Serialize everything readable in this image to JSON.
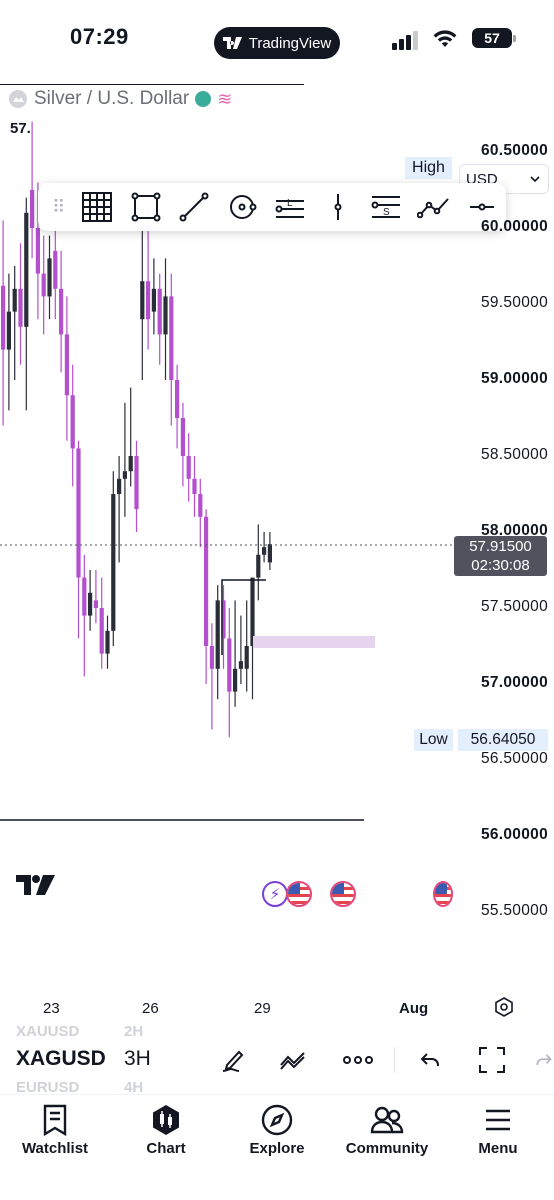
{
  "status_bar": {
    "time": "07:29",
    "app_pill": "TradingView",
    "battery": "57"
  },
  "chart": {
    "symbol_title": "Silver / U.S. Dollar",
    "open_value": "57.",
    "high_label": "High",
    "low_label": "Low",
    "low_value": "56.64050",
    "currency": "USD",
    "last_price": "57.91500",
    "countdown": "02:30:08",
    "price_ticks": [
      {
        "label": "60.50000",
        "bold": true
      },
      {
        "label": "60.00000",
        "bold": true
      },
      {
        "label": "59.50000",
        "bold": false
      },
      {
        "label": "59.00000",
        "bold": true
      },
      {
        "label": "58.50000",
        "bold": false
      },
      {
        "label": "58.00000",
        "bold": true
      },
      {
        "label": "57.50000",
        "bold": false
      },
      {
        "label": "57.00000",
        "bold": true
      },
      {
        "label": "56.50000",
        "bold": false
      },
      {
        "label": "56.00000",
        "bold": true
      },
      {
        "label": "55.50000",
        "bold": false
      }
    ],
    "time_labels": [
      "23",
      "26",
      "29",
      "Aug"
    ],
    "colors": {
      "down": "#b44fce",
      "up": "#2a2e39",
      "zone": "#e6d4ef",
      "accent_badge": "#e3effd"
    }
  },
  "drawing_tools": [
    {
      "name": "grid-icon"
    },
    {
      "name": "rectangle-icon"
    },
    {
      "name": "trend-line-icon"
    },
    {
      "name": "circle-icon"
    },
    {
      "name": "long-position-icon"
    },
    {
      "name": "vertical-line-icon"
    },
    {
      "name": "short-position-icon"
    },
    {
      "name": "path-icon"
    },
    {
      "name": "horizontal-ray-icon"
    }
  ],
  "symbol_bar": {
    "prev_symbol": "XAUUSD",
    "prev_interval": "2H",
    "symbol": "XAGUSD",
    "interval": "3H",
    "next_symbol": "EURUSD",
    "next_interval": "4H"
  },
  "tabs": [
    {
      "label": "Watchlist",
      "icon": "watchlist-icon"
    },
    {
      "label": "Chart",
      "icon": "chart-icon"
    },
    {
      "label": "Explore",
      "icon": "compass-icon"
    },
    {
      "label": "Community",
      "icon": "community-icon"
    },
    {
      "label": "Menu",
      "icon": "menu-icon"
    }
  ],
  "candles": [
    {
      "t": 0,
      "o": 59.62,
      "h": 60.05,
      "l": 58.7,
      "c": 59.2
    },
    {
      "t": 1,
      "o": 59.2,
      "h": 59.7,
      "l": 58.8,
      "c": 59.45
    },
    {
      "t": 2,
      "o": 59.45,
      "h": 59.75,
      "l": 59.0,
      "c": 59.6
    },
    {
      "t": 3,
      "o": 59.6,
      "h": 59.9,
      "l": 59.1,
      "c": 59.35
    },
    {
      "t": 4,
      "o": 59.35,
      "h": 60.2,
      "l": 58.8,
      "c": 60.1
    },
    {
      "t": 5,
      "o": 60.25,
      "h": 60.7,
      "l": 59.8,
      "c": 60.0
    },
    {
      "t": 6,
      "o": 60.0,
      "h": 60.3,
      "l": 59.4,
      "c": 59.7
    },
    {
      "t": 7,
      "o": 59.7,
      "h": 59.95,
      "l": 59.3,
      "c": 59.55
    },
    {
      "t": 8,
      "o": 59.55,
      "h": 59.95,
      "l": 59.4,
      "c": 59.8
    },
    {
      "t": 9,
      "o": 59.85,
      "h": 60.0,
      "l": 59.4,
      "c": 59.6
    },
    {
      "t": 10,
      "o": 59.6,
      "h": 59.85,
      "l": 59.05,
      "c": 59.3
    },
    {
      "t": 11,
      "o": 59.3,
      "h": 59.55,
      "l": 58.6,
      "c": 58.9
    },
    {
      "t": 12,
      "o": 58.9,
      "h": 59.1,
      "l": 58.3,
      "c": 58.55
    },
    {
      "t": 13,
      "o": 58.55,
      "h": 58.6,
      "l": 57.3,
      "c": 57.7
    },
    {
      "t": 14,
      "o": 57.7,
      "h": 57.85,
      "l": 57.05,
      "c": 57.45
    },
    {
      "t": 15,
      "o": 57.45,
      "h": 57.75,
      "l": 57.35,
      "c": 57.6
    },
    {
      "t": 16,
      "o": 57.55,
      "h": 57.75,
      "l": 57.4,
      "c": 57.5
    },
    {
      "t": 17,
      "o": 57.5,
      "h": 57.7,
      "l": 57.1,
      "c": 57.2
    },
    {
      "t": 18,
      "o": 57.2,
      "h": 57.45,
      "l": 57.1,
      "c": 57.35
    },
    {
      "t": 19,
      "o": 57.35,
      "h": 58.4,
      "l": 57.25,
      "c": 58.25
    },
    {
      "t": 20,
      "o": 58.25,
      "h": 58.5,
      "l": 57.8,
      "c": 58.35
    },
    {
      "t": 21,
      "o": 58.35,
      "h": 58.85,
      "l": 58.1,
      "c": 58.4
    },
    {
      "t": 22,
      "o": 58.4,
      "h": 58.95,
      "l": 58.3,
      "c": 58.5
    },
    {
      "t": 23,
      "o": 58.5,
      "h": 58.6,
      "l": 58.0,
      "c": 58.15
    },
    {
      "t": 24,
      "o": 59.4,
      "h": 60.0,
      "l": 59.0,
      "c": 59.65
    },
    {
      "t": 25,
      "o": 59.65,
      "h": 60.1,
      "l": 59.2,
      "c": 59.4
    },
    {
      "t": 26,
      "o": 59.45,
      "h": 59.8,
      "l": 59.3,
      "c": 59.6
    },
    {
      "t": 27,
      "o": 59.6,
      "h": 59.7,
      "l": 59.1,
      "c": 59.3
    },
    {
      "t": 28,
      "o": 59.3,
      "h": 59.8,
      "l": 59.0,
      "c": 59.55
    },
    {
      "t": 29,
      "o": 59.55,
      "h": 59.7,
      "l": 58.7,
      "c": 59.0
    },
    {
      "t": 30,
      "o": 59.0,
      "h": 59.1,
      "l": 58.55,
      "c": 58.75
    },
    {
      "t": 31,
      "o": 58.75,
      "h": 58.85,
      "l": 58.3,
      "c": 58.5
    },
    {
      "t": 32,
      "o": 58.5,
      "h": 58.65,
      "l": 58.2,
      "c": 58.35
    },
    {
      "t": 33,
      "o": 58.35,
      "h": 58.5,
      "l": 58.1,
      "c": 58.25
    },
    {
      "t": 34,
      "o": 58.25,
      "h": 58.35,
      "l": 57.9,
      "c": 58.1
    },
    {
      "t": 35,
      "o": 58.1,
      "h": 58.15,
      "l": 57.0,
      "c": 57.25
    },
    {
      "t": 36,
      "o": 57.25,
      "h": 57.4,
      "l": 56.7,
      "c": 57.1
    },
    {
      "t": 37,
      "o": 57.1,
      "h": 57.65,
      "l": 56.9,
      "c": 57.55
    },
    {
      "t": 38,
      "o": 57.55,
      "h": 57.65,
      "l": 57.1,
      "c": 57.3
    },
    {
      "t": 39,
      "o": 57.3,
      "h": 57.5,
      "l": 56.65,
      "c": 56.95
    },
    {
      "t": 40,
      "o": 56.95,
      "h": 57.55,
      "l": 56.85,
      "c": 57.1
    },
    {
      "t": 41,
      "o": 57.1,
      "h": 57.45,
      "l": 57.0,
      "c": 57.15
    },
    {
      "t": 42,
      "o": 57.1,
      "h": 57.55,
      "l": 56.95,
      "c": 57.25
    },
    {
      "t": 43,
      "o": 57.25,
      "h": 57.7,
      "l": 56.9,
      "c": 57.7
    },
    {
      "t": 44,
      "o": 57.7,
      "h": 58.05,
      "l": 57.55,
      "c": 57.85
    },
    {
      "t": 45,
      "o": 57.85,
      "h": 58.0,
      "l": 57.8,
      "c": 57.9
    },
    {
      "t": 46,
      "o": 57.8,
      "h": 58.0,
      "l": 57.75,
      "c": 57.92
    }
  ]
}
